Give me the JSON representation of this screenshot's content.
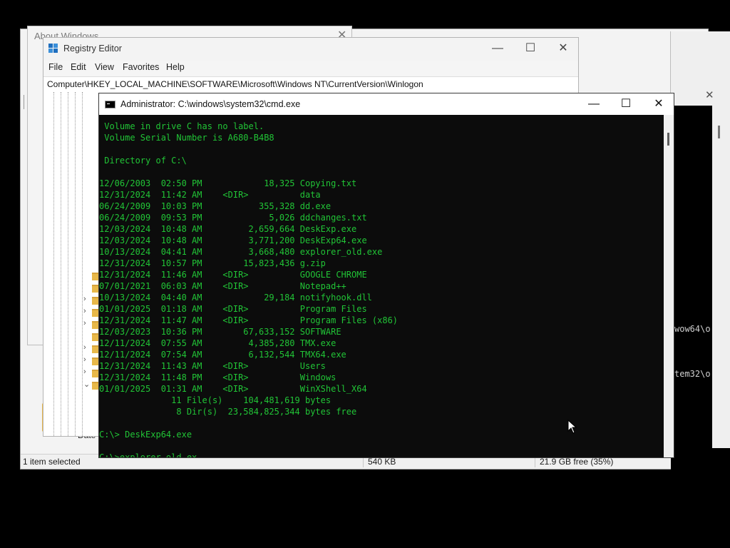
{
  "explorer": {
    "status": {
      "selection": "1 item selected",
      "size": "540 KB",
      "free": "21.9 GB free (35%)"
    },
    "date_label": "Date"
  },
  "right_window": {
    "line1": "wow64\\o",
    "line2": "tem32\\o"
  },
  "about": {
    "title": "About Windows"
  },
  "regedit": {
    "title": "Registry Editor",
    "menu": [
      "File",
      "Edit",
      "View",
      "Favorites",
      "Help"
    ],
    "address": "Computer\\HKEY_LOCAL_MACHINE\\SOFTWARE\\Microsoft\\Windows NT\\CurrentVersion\\Winlogon"
  },
  "cmd": {
    "title": "Administrator: C:\\windows\\system32\\cmd.exe",
    "lines": [
      " Volume in drive C has no label.",
      " Volume Serial Number is A680-B4B8",
      "",
      " Directory of C:\\",
      "",
      "12/06/2003  02:50 PM            18,325 Copying.txt",
      "12/31/2024  11:42 AM    <DIR>          data",
      "06/24/2009  10:03 PM           355,328 dd.exe",
      "06/24/2009  09:53 PM             5,026 ddchanges.txt",
      "12/03/2024  10:48 AM         2,659,664 DeskExp.exe",
      "12/03/2024  10:48 AM         3,771,200 DeskExp64.exe",
      "10/13/2024  04:41 AM         3,668,480 explorer_old.exe",
      "12/31/2024  10:57 PM        15,823,436 g.zip",
      "12/31/2024  11:46 AM    <DIR>          GOOGLE CHROME",
      "07/01/2021  06:03 AM    <DIR>          Notepad++",
      "10/13/2024  04:40 AM            29,184 notifyhook.dll",
      "01/01/2025  01:18 AM    <DIR>          Program Files",
      "12/31/2024  11:47 AM    <DIR>          Program Files (x86)",
      "12/03/2023  10:36 PM        67,633,152 SOFTWARE",
      "12/11/2024  07:55 AM         4,385,280 TMX.exe",
      "12/11/2024  07:54 AM         6,132,544 TMX64.exe",
      "12/31/2024  11:43 AM    <DIR>          Users",
      "12/31/2024  11:48 PM    <DIR>          Windows",
      "01/01/2025  01:31 AM    <DIR>          WinXShell_X64",
      "              11 File(s)    104,481,619 bytes",
      "               8 Dir(s)  23,584,825,344 bytes free",
      "",
      "C:\\> DeskExp64.exe",
      "",
      "C:\\>explorer_old.ex"
    ]
  },
  "colors": {
    "console_text": "#21c436",
    "console_bg": "#0c0c0c"
  }
}
